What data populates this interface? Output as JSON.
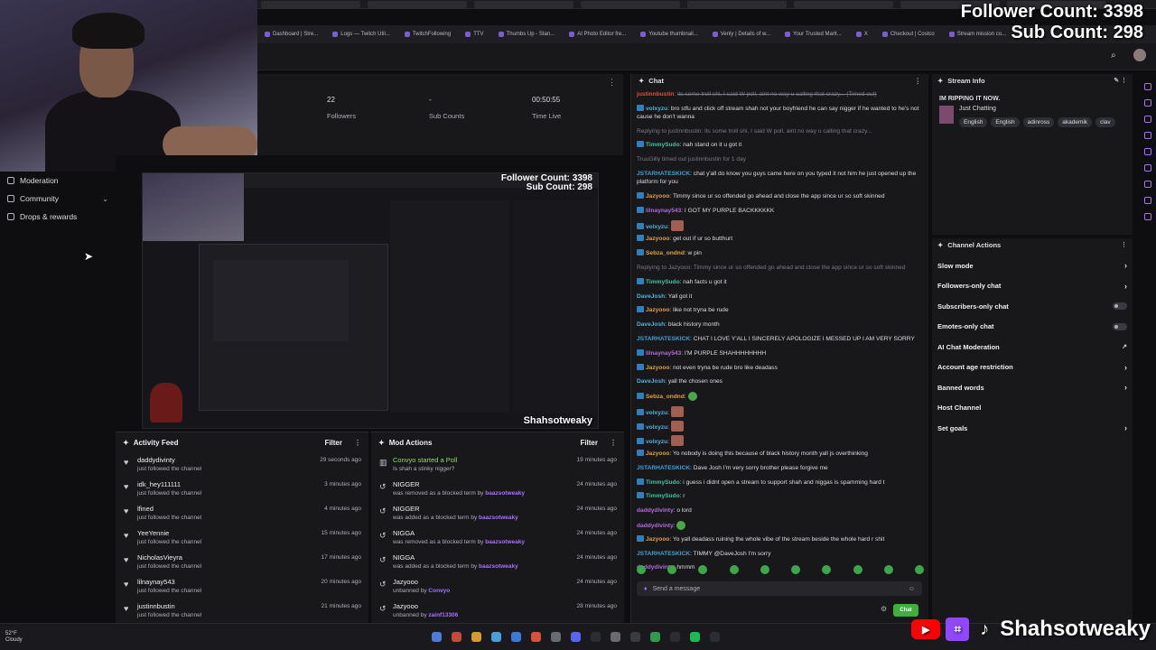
{
  "overlay": {
    "follower_count": "Follower Count: 3398",
    "sub_count": "Sub Count: 298"
  },
  "preview_overlay": {
    "follower_count": "Follower Count: 3398",
    "sub_count": "Sub Count: 298",
    "name": "Shahsotweaky"
  },
  "bookmarks": [
    "Dashboard | Stre...",
    "Logs — Twitch Util...",
    "TwitchFollowing",
    "TTV",
    "Thumbs Up - Stan...",
    "AI Photo Editor fre...",
    "Youtube thumbnail...",
    "Venly | Details of w...",
    "Your Trusted Marit...",
    "X",
    "Checkout | Costco",
    "Stream mission co..."
  ],
  "sidebar": [
    {
      "label": "Moderation",
      "icon": "shield-icon"
    },
    {
      "label": "Community",
      "icon": "people-icon",
      "chevron": "⌄"
    },
    {
      "label": "Drops & rewards",
      "icon": "gift-icon"
    }
  ],
  "stats": {
    "followers": {
      "value": "22",
      "label": "Followers"
    },
    "subs": {
      "value": "-",
      "label": "Sub Counts"
    },
    "time": {
      "value": "00:50:55",
      "label": "Time Live"
    }
  },
  "activity_feed": {
    "title": "Activity Feed",
    "filter": "Filter",
    "items": [
      {
        "name": "daddydivinty",
        "sub": "just followed the channel",
        "time": "29 seconds ago"
      },
      {
        "name": "idk_hey111111",
        "sub": "just followed the channel",
        "time": "3 minutes ago"
      },
      {
        "name": "lfined",
        "sub": "just followed the channel",
        "time": "4 minutes ago"
      },
      {
        "name": "YeeYennie",
        "sub": "just followed the channel",
        "time": "15 minutes ago"
      },
      {
        "name": "NicholasVieyra",
        "sub": "just followed the channel",
        "time": "17 minutes ago"
      },
      {
        "name": "lilnaynay543",
        "sub": "just followed the channel",
        "time": "20 minutes ago"
      },
      {
        "name": "justinnbustin",
        "sub": "just followed the channel",
        "time": "21 minutes ago"
      }
    ]
  },
  "mod_actions": {
    "title": "Mod Actions",
    "filter": "Filter",
    "items": [
      {
        "name": "Convyo started a Poll",
        "sub": "Is shah a stinky nigger?",
        "by": "",
        "time": "19 minutes ago",
        "green": true
      },
      {
        "name": "NIGGER",
        "sub": "was removed as a blocked term by ",
        "by": "baazsotweaky",
        "time": "24 minutes ago"
      },
      {
        "name": "NIGGER",
        "sub": "was added as a blocked term by ",
        "by": "baazsotweaky",
        "time": "24 minutes ago"
      },
      {
        "name": "NIGGA",
        "sub": "was removed as a blocked term by ",
        "by": "baazsotweaky",
        "time": "24 minutes ago"
      },
      {
        "name": "NIGGA",
        "sub": "was added as a blocked term by ",
        "by": "baazsotweaky",
        "time": "24 minutes ago"
      },
      {
        "name": "Jazyooo",
        "sub": "unbanned by ",
        "by": "Convyo",
        "time": "24 minutes ago"
      },
      {
        "name": "Jazyooo",
        "sub": "unbanned by ",
        "by": "zainf13306",
        "time": "28 minutes ago"
      }
    ]
  },
  "chat": {
    "title": "Chat",
    "placeholder": "Send a message",
    "send_label": "Chat",
    "messages": [
      {
        "user": "justinnbustin",
        "text": "its some troll shi, I said W poll, aint no way u calling that crazy... (Timed out)",
        "color": "#e0503c",
        "sys": true,
        "badge": false,
        "strike": true
      },
      {
        "user": "volxyzu",
        "text": "bro stfu and click off stream shah not your boyfriend he can say nigger if he wanted to he's not cause he don't wanna",
        "color": "#4fb3d9",
        "badge": true,
        "lines": 2
      },
      {
        "user": "",
        "text": "Replying to justinnbustin: its some troll shi, I said W poll, aint no way u calling that crazy...",
        "sys": true,
        "badge": false
      },
      {
        "user": "TimmySudo",
        "text": "nah stand on it u got it",
        "color": "#39c39b",
        "badge": true
      },
      {
        "user": "",
        "text": "TruuGilly timed out justinnbustin for 1 day",
        "sys": true,
        "badge": false
      },
      {
        "user": "JSTARHATESKICK",
        "text": "chat y'all do know you guys came here on you typed it not him he just opened up the platform for you",
        "color": "#3fa0d6",
        "badge": false,
        "lines": 2
      },
      {
        "user": "Jazyooo",
        "text": "Timmy since ur so offended go ahead and close the app since ur so soft skinned",
        "color": "#e0a13c",
        "badge": true
      },
      {
        "user": "lilnaynay543",
        "text": "I GOT MY PURPLE BACKKKKKK",
        "color": "#b26bd9",
        "badge": true
      },
      {
        "user": "volxyzu",
        "text": "",
        "color": "#4fb3d9",
        "badge": true,
        "emote": "face"
      },
      {
        "user": "Jazyooo",
        "text": "get out if ur so butthurt",
        "color": "#e0a13c",
        "badge": true
      },
      {
        "user": "Sebza_ondnd",
        "text": "w pin",
        "color": "#e0a13c",
        "badge": true
      },
      {
        "user": "",
        "text": "Replying to Jazyooo: Timmy since ur so offended go ahead and close the app since ur so soft skinned",
        "sys": true,
        "badge": false
      },
      {
        "user": "TimmySudo",
        "text": "nah facts u got it",
        "color": "#39c39b",
        "badge": true
      },
      {
        "user": "DaveJosh",
        "text": "Yall got it",
        "color": "#4fb3d9",
        "badge": false
      },
      {
        "user": "Jazyooo",
        "text": "like not tryna be rude",
        "color": "#e0a13c",
        "badge": true
      },
      {
        "user": "DaveJosh",
        "text": "black history month",
        "color": "#4fb3d9",
        "badge": false
      },
      {
        "user": "JSTARHATESKICK",
        "text": "CHAT I LOVE Y'ALL I SINCERELY APOLOGIZE I MESSED UP I AM VERY SORRY",
        "color": "#3fa0d6",
        "badge": false
      },
      {
        "user": "lilnaynay543",
        "text": "I'M PURPLE SHAHHHHHHHH",
        "color": "#b26bd9",
        "badge": true
      },
      {
        "user": "Jazyooo",
        "text": "not even tryna be rude bro like deadass",
        "color": "#e0a13c",
        "badge": true
      },
      {
        "user": "DaveJosh",
        "text": "yall the chosen ones",
        "color": "#4fb3d9",
        "badge": false
      },
      {
        "user": "Sebza_ondnd",
        "text": "",
        "color": "#e0a13c",
        "badge": true,
        "emote": "green"
      },
      {
        "user": "volxyzu",
        "text": "",
        "color": "#4fb3d9",
        "badge": true,
        "emote": "face"
      },
      {
        "user": "volxyzu",
        "text": "",
        "color": "#4fb3d9",
        "badge": true,
        "emote": "face"
      },
      {
        "user": "volxyzu",
        "text": "",
        "color": "#4fb3d9",
        "badge": true,
        "emote": "face"
      },
      {
        "user": "Jazyooo",
        "text": "Yo nobody is doing this because of black history month yall js overthinking",
        "color": "#e0a13c",
        "badge": true
      },
      {
        "user": "JSTARHATESKICK",
        "text": "Dave Josh I'm very sorry brother please forgive me",
        "color": "#3fa0d6",
        "badge": false
      },
      {
        "user": "TimmySudo",
        "text": "i guess i didnt open a stream to support shah and niggas is spamming hard t",
        "color": "#39c39b",
        "badge": true
      },
      {
        "user": "TimmySudo",
        "text": "r",
        "color": "#39c39b",
        "badge": true
      },
      {
        "user": "daddydivinty",
        "text": "o lord",
        "color": "#b26bd9",
        "badge": false
      },
      {
        "user": "daddydivinty",
        "text": "",
        "color": "#b26bd9",
        "badge": false,
        "emote": "green"
      },
      {
        "user": "Jazyooo",
        "text": "Yo yall deadass ruining the whole vibe of the stream beside the whole hard r shit",
        "color": "#e0a13c",
        "badge": true
      },
      {
        "user": "JSTARHATESKICK",
        "text": "TIMMY @DaveJosh I'm sorry",
        "color": "#3fa0d6",
        "badge": false
      },
      {
        "user": "daddydivinty",
        "text": "hmmm",
        "color": "#b26bd9",
        "badge": false
      }
    ]
  },
  "stream_info": {
    "title": "Stream Info",
    "stream_title": "IM RIPPING IT NOW.",
    "category": "Just Chatting",
    "tags": [
      "English",
      "English",
      "adinross",
      "akademik",
      "clav"
    ]
  },
  "channel_actions": {
    "title": "Channel Actions",
    "items": [
      {
        "label": "Slow mode",
        "control": "chevron"
      },
      {
        "label": "Followers-only chat",
        "control": "chevron"
      },
      {
        "label": "Subscribers-only chat",
        "control": "toggle"
      },
      {
        "label": "Emotes-only chat",
        "control": "toggle"
      },
      {
        "label": "AI Chat Moderation",
        "control": "link"
      },
      {
        "label": "Account age restriction",
        "control": "chevron"
      },
      {
        "label": "Banned words",
        "control": "chevron"
      },
      {
        "label": "Host Channel",
        "control": "none"
      },
      {
        "label": "Set goals",
        "control": "chevron"
      }
    ]
  },
  "taskbar": {
    "temp": "52°F",
    "weather": "Cloudy"
  },
  "branding": {
    "name": "Shahsotweaky"
  },
  "colors": {
    "accent": "#a970ff",
    "chat_button": "#3fae3f",
    "background": "#0e0e10",
    "panel": "#18181b"
  }
}
